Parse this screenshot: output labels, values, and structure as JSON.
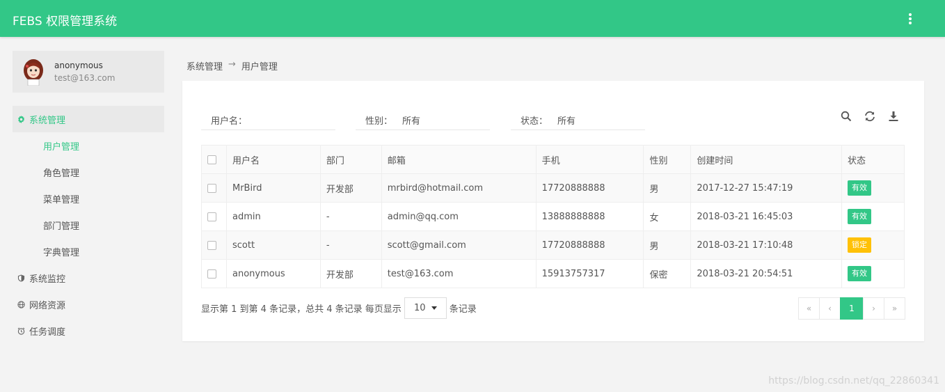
{
  "app": {
    "title": "FEBS 权限管理系统",
    "menu_icon": "more-vertical-icon"
  },
  "user": {
    "name": "anonymous",
    "email": "test@163.com"
  },
  "sidebar": {
    "sections": [
      {
        "label": "系统管理",
        "icon": "gear-icon",
        "active": true
      },
      {
        "label": "系统监控",
        "icon": "shield-icon"
      },
      {
        "label": "网络资源",
        "icon": "globe-icon"
      },
      {
        "label": "任务调度",
        "icon": "alarm-clock-icon"
      }
    ],
    "sub_items": [
      {
        "label": "用户管理",
        "active": true
      },
      {
        "label": "角色管理"
      },
      {
        "label": "菜单管理"
      },
      {
        "label": "部门管理"
      },
      {
        "label": "字典管理"
      }
    ]
  },
  "breadcrumb": {
    "parent": "系统管理",
    "separator": "→",
    "current": "用户管理"
  },
  "filters": {
    "username": {
      "label": "用户名：",
      "value": ""
    },
    "gender": {
      "label": "性别：",
      "value": "所有"
    },
    "status": {
      "label": "状态：",
      "value": "所有"
    }
  },
  "toolbar": {
    "search": "search-icon",
    "refresh": "refresh-icon",
    "export": "download-icon"
  },
  "table": {
    "columns": [
      "用户名",
      "部门",
      "邮箱",
      "手机",
      "性别",
      "创建时间",
      "状态"
    ],
    "rows": [
      {
        "username": "MrBird",
        "dept": "开发部",
        "email": "mrbird@hotmail.com",
        "phone": "17720888888",
        "gender": "男",
        "created": "2017-12-27 15:47:19",
        "status": "有效"
      },
      {
        "username": "admin",
        "dept": "-",
        "email": "admin@qq.com",
        "phone": "13888888888",
        "gender": "女",
        "created": "2018-03-21 16:45:03",
        "status": "有效"
      },
      {
        "username": "scott",
        "dept": "-",
        "email": "scott@gmail.com",
        "phone": "17720888888",
        "gender": "男",
        "created": "2018-03-21 17:10:48",
        "status": "锁定"
      },
      {
        "username": "anonymous",
        "dept": "开发部",
        "email": "test@163.com",
        "phone": "15913757317",
        "gender": "保密",
        "created": "2018-03-21 20:54:51",
        "status": "有效"
      }
    ]
  },
  "pager": {
    "info_prefix": "显示第 1 到第 4 条记录，总共 4 条记录 每页显示",
    "page_size": "10",
    "info_suffix": "条记录",
    "first": "«",
    "prev": "‹",
    "current": "1",
    "next": "›",
    "last": "»"
  },
  "colors": {
    "brand": "#32c787",
    "active_badge": "#32c787",
    "locked_badge": "#ffc107"
  },
  "watermark": "https://blog.csdn.net/qq_22860341"
}
